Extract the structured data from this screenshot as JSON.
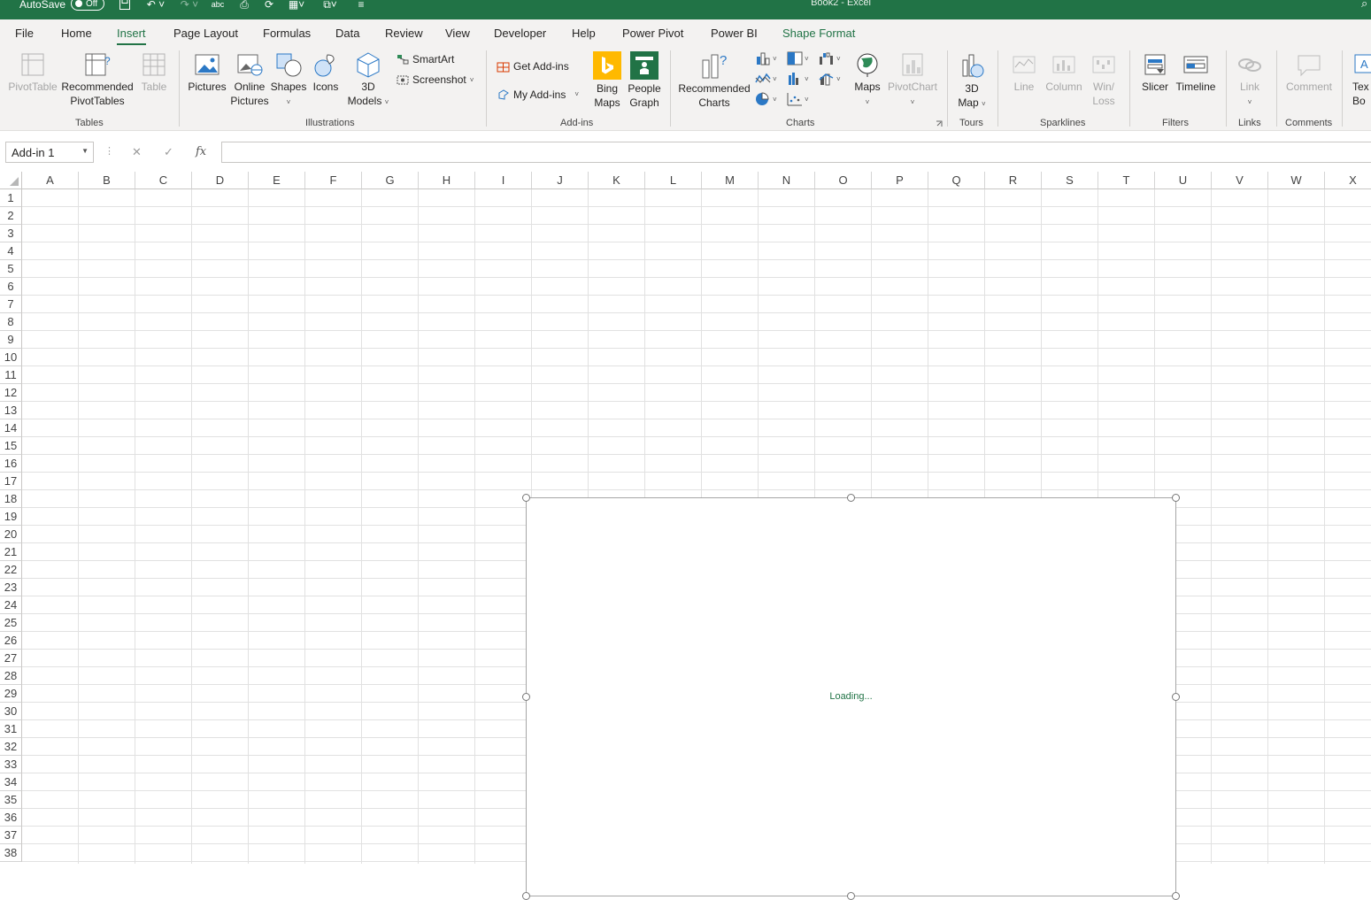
{
  "titlebar": {
    "autosave_label": "AutoSave",
    "autosave_state": "Off",
    "document_title": "Book2  -  Excel"
  },
  "tabs": [
    "File",
    "Home",
    "Insert",
    "Page Layout",
    "Formulas",
    "Data",
    "Review",
    "View",
    "Developer",
    "Help",
    "Power Pivot",
    "Power BI",
    "Shape Format"
  ],
  "active_tab": "Insert",
  "ribbon": {
    "tables": {
      "label": "Tables",
      "pivot_table": "PivotTable",
      "rec_pivot_1": "Recommended",
      "rec_pivot_2": "PivotTables",
      "table": "Table"
    },
    "illustrations": {
      "label": "Illustrations",
      "pictures": "Pictures",
      "online_1": "Online",
      "online_2": "Pictures",
      "shapes": "Shapes",
      "icons": "Icons",
      "models_1": "3D",
      "models_2": "Models",
      "smartart": "SmartArt",
      "screenshot": "Screenshot"
    },
    "addins": {
      "label": "Add-ins",
      "get_addins": "Get Add-ins",
      "my_addins": "My Add-ins",
      "bing_1": "Bing",
      "bing_2": "Maps",
      "people_1": "People",
      "people_2": "Graph"
    },
    "charts": {
      "label": "Charts",
      "rec_1": "Recommended",
      "rec_2": "Charts",
      "maps": "Maps",
      "pivotchart": "PivotChart"
    },
    "tours": {
      "label": "Tours",
      "map_1": "3D",
      "map_2": "Map"
    },
    "sparklines": {
      "label": "Sparklines",
      "line": "Line",
      "column": "Column",
      "winloss_1": "Win/",
      "winloss_2": "Loss"
    },
    "filters": {
      "label": "Filters",
      "slicer": "Slicer",
      "timeline": "Timeline"
    },
    "links": {
      "label": "Links",
      "link": "Link"
    },
    "comments": {
      "label": "Comments",
      "comment": "Comment"
    },
    "text": {
      "textbox_1": "Tex",
      "textbox_2": "Bo"
    }
  },
  "formula_bar": {
    "name_box": "Add-in 1",
    "fx": "fx",
    "value": ""
  },
  "columns": [
    "A",
    "B",
    "C",
    "D",
    "E",
    "F",
    "G",
    "H",
    "I",
    "J",
    "K",
    "L",
    "M",
    "N",
    "O",
    "P",
    "Q",
    "R",
    "S",
    "T",
    "U",
    "V",
    "W",
    "X"
  ],
  "rows": [
    "1",
    "2",
    "3",
    "4",
    "5",
    "6",
    "7",
    "8",
    "9",
    "10",
    "11",
    "12",
    "13",
    "14",
    "15",
    "16",
    "17",
    "18",
    "19",
    "20",
    "21",
    "22",
    "23",
    "24",
    "25",
    "26",
    "27",
    "28",
    "29",
    "30",
    "31",
    "32",
    "33",
    "34",
    "35",
    "36",
    "37",
    "38"
  ],
  "addin_frame": {
    "status_text": "Loading..."
  },
  "colors": {
    "excel_green": "#217346",
    "ribbon_bg": "#f3f2f1"
  }
}
